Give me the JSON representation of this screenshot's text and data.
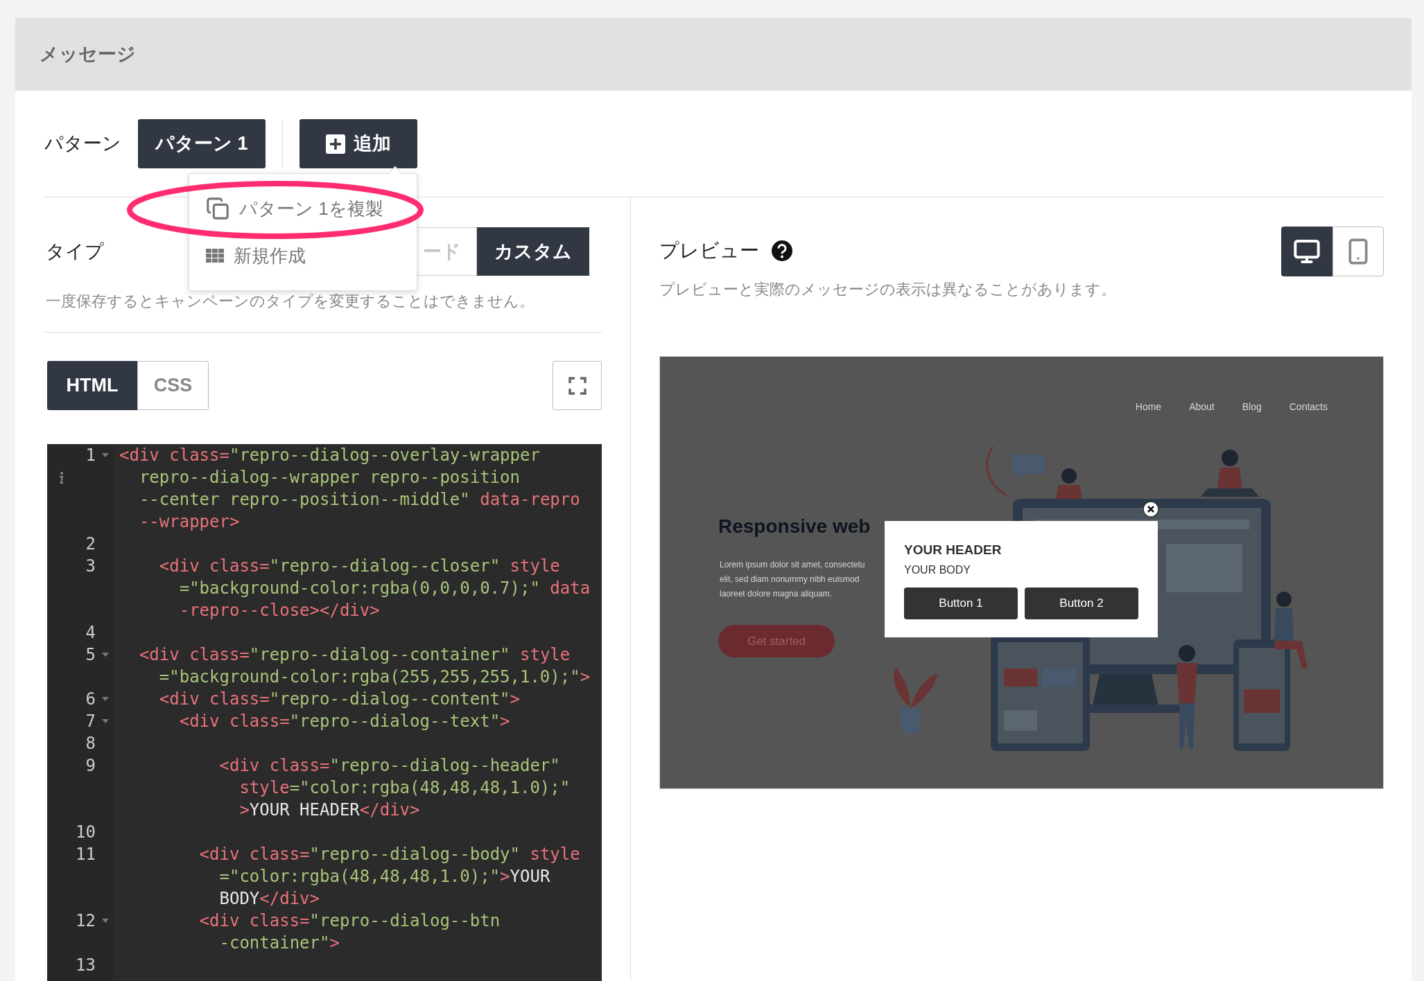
{
  "section": {
    "title": "メッセージ"
  },
  "pattern": {
    "label": "パターン",
    "tabs": [
      {
        "label": "パターン 1",
        "selected": true
      }
    ],
    "add_button": "追加"
  },
  "pattern_menu": {
    "items": [
      {
        "kind": "duplicate",
        "label": "パターン 1を複製",
        "circled": true
      },
      {
        "kind": "new",
        "label": "新規作成",
        "circled": false
      }
    ]
  },
  "type": {
    "label": "タイプ",
    "options": [
      {
        "label": "ード",
        "selected": false
      },
      {
        "label": "カスタム",
        "selected": true
      }
    ],
    "note": "一度保存するとキャンペーンのタイプを変更することはできません。"
  },
  "editor": {
    "tabs": [
      {
        "label": "HTML",
        "selected": true
      },
      {
        "label": "CSS",
        "selected": false
      }
    ],
    "lines": [
      {
        "number": "1",
        "fold": true,
        "info": true,
        "rows": [
          {
            "segments": [
              {
                "kind": "tag",
                "text": "<div class="
              },
              {
                "kind": "string",
                "text": "\"repro--dialog--overlay-wrapper"
              }
            ]
          },
          {
            "segments": [
              {
                "kind": "string",
                "text": "  repro--dialog--wrapper repro--position"
              }
            ]
          },
          {
            "segments": [
              {
                "kind": "string",
                "text": "  --center repro--position--middle\""
              },
              {
                "kind": "tag",
                "text": " data-repro"
              }
            ]
          },
          {
            "segments": [
              {
                "kind": "tag",
                "text": "  --wrapper>"
              }
            ]
          }
        ]
      },
      {
        "number": "2",
        "fold": false,
        "info": false
      },
      {
        "number": "3",
        "fold": false,
        "info": false,
        "rows": [
          {
            "segments": [
              {
                "kind": "tag",
                "text": "    <div class="
              },
              {
                "kind": "string",
                "text": "\"repro--dialog--closer\""
              },
              {
                "kind": "tag",
                "text": " style"
              }
            ]
          },
          {
            "segments": [
              {
                "kind": "string",
                "text": "      =\"background-color:rgba(0,0,0,0.7);\""
              },
              {
                "kind": "tag",
                "text": " data"
              }
            ]
          },
          {
            "segments": [
              {
                "kind": "tag",
                "text": "      -repro--close></div>"
              }
            ]
          }
        ]
      },
      {
        "number": "4",
        "fold": false,
        "info": false
      },
      {
        "number": "5",
        "fold": true,
        "info": false,
        "rows": [
          {
            "segments": [
              {
                "kind": "tag",
                "text": "  <div class="
              },
              {
                "kind": "string",
                "text": "\"repro--dialog--container\""
              },
              {
                "kind": "tag",
                "text": " style"
              }
            ]
          },
          {
            "segments": [
              {
                "kind": "string",
                "text": "    =\"background-color:rgba(255,255,255,1.0);\""
              },
              {
                "kind": "tag",
                "text": ">"
              }
            ]
          }
        ]
      },
      {
        "number": "6",
        "fold": true,
        "info": false,
        "rows": [
          {
            "segments": [
              {
                "kind": "tag",
                "text": "    <div class="
              },
              {
                "kind": "string",
                "text": "\"repro--dialog--content\""
              },
              {
                "kind": "tag",
                "text": ">"
              }
            ]
          }
        ]
      },
      {
        "number": "7",
        "fold": true,
        "info": false,
        "rows": [
          {
            "segments": [
              {
                "kind": "tag",
                "text": "      <div class="
              },
              {
                "kind": "string",
                "text": "\"repro--dialog--text\""
              },
              {
                "kind": "tag",
                "text": ">"
              }
            ]
          }
        ]
      },
      {
        "number": "8",
        "fold": false,
        "info": false
      },
      {
        "number": "9",
        "fold": false,
        "info": false,
        "rows": [
          {
            "segments": [
              {
                "kind": "tag",
                "text": "          <div class="
              },
              {
                "kind": "string",
                "text": "\"repro--dialog--header\""
              }
            ]
          },
          {
            "segments": [
              {
                "kind": "tag",
                "text": "            style"
              },
              {
                "kind": "string",
                "text": "=\"color:rgba(48,48,48,1.0);\""
              }
            ]
          },
          {
            "segments": [
              {
                "kind": "tag",
                "text": "            >"
              },
              {
                "kind": "plain",
                "text": "YOUR HEADER"
              },
              {
                "kind": "tag",
                "text": "</div>"
              }
            ]
          }
        ]
      },
      {
        "number": "10",
        "fold": false,
        "info": false
      },
      {
        "number": "11",
        "fold": false,
        "info": false,
        "rows": [
          {
            "segments": [
              {
                "kind": "tag",
                "text": "        <div class="
              },
              {
                "kind": "string",
                "text": "\"repro--dialog--body\""
              },
              {
                "kind": "tag",
                "text": " style"
              }
            ]
          },
          {
            "segments": [
              {
                "kind": "string",
                "text": "          =\"color:rgba(48,48,48,1.0);\""
              },
              {
                "kind": "tag",
                "text": ">"
              },
              {
                "kind": "plain",
                "text": "YOUR"
              }
            ]
          },
          {
            "segments": [
              {
                "kind": "plain",
                "text": "          BODY"
              },
              {
                "kind": "tag",
                "text": "</div>"
              }
            ]
          }
        ]
      },
      {
        "number": "12",
        "fold": true,
        "info": false,
        "rows": [
          {
            "segments": [
              {
                "kind": "tag",
                "text": "        <div class="
              },
              {
                "kind": "string",
                "text": "\"repro--dialog--btn"
              }
            ]
          },
          {
            "segments": [
              {
                "kind": "string",
                "text": "          -container\""
              },
              {
                "kind": "tag",
                "text": ">"
              }
            ]
          }
        ]
      },
      {
        "number": "13",
        "fold": false,
        "info": false
      }
    ]
  },
  "preview": {
    "title": "プレビュー",
    "note": "プレビューと実際のメッセージの表示は異なることがあります。",
    "devices": [
      {
        "kind": "desktop",
        "selected": true
      },
      {
        "kind": "mobile",
        "selected": false
      }
    ],
    "site": {
      "nav": [
        "Home",
        "About",
        "Blog",
        "Contacts"
      ],
      "heading": "Responsive web",
      "body": [
        "Lorem ipsum dolor sit amet, consectetu",
        "elit, sed diam nonummy nibh euismod",
        "laoreet dolore magna aliquam."
      ],
      "button": "Get started"
    },
    "dialog": {
      "header": "YOUR HEADER",
      "body": "YOUR BODY",
      "buttons": [
        "Button 1",
        "Button 2"
      ]
    }
  }
}
